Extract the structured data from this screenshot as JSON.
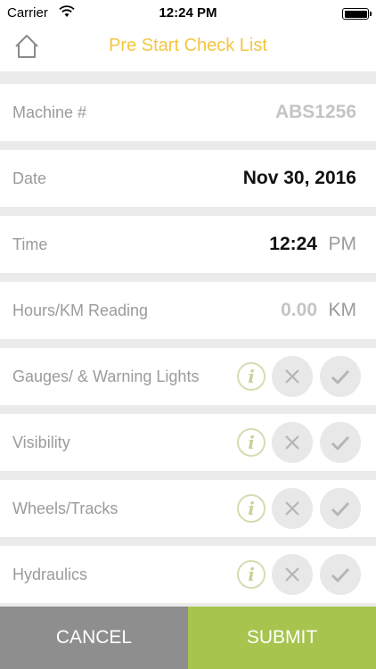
{
  "status_bar": {
    "carrier": "Carrier",
    "time": "12:24 PM",
    "wifi_icon": "wifi-icon",
    "battery_icon": "battery-icon"
  },
  "nav": {
    "title": "Pre Start Check List",
    "home_icon": "home-icon"
  },
  "fields": {
    "machine": {
      "label": "Machine #",
      "value": "ABS1256"
    },
    "date": {
      "label": "Date",
      "value": "Nov 30, 2016"
    },
    "time": {
      "label": "Time",
      "value": "12:24",
      "suffix": "PM"
    },
    "hours": {
      "label": "Hours/KM Reading",
      "value": "0.00",
      "unit": "KM"
    }
  },
  "checks": [
    {
      "label": "Gauges/ & Warning Lights"
    },
    {
      "label": "Visibility"
    },
    {
      "label": "Wheels/Tracks"
    },
    {
      "label": "Hydraulics"
    }
  ],
  "actions": {
    "cancel_label": "CANCEL",
    "submit_label": "SUBMIT"
  },
  "colors": {
    "title": "#f4c542",
    "submit": "#a6c44e",
    "cancel": "#8e8e8e",
    "info": "#c9d19a"
  }
}
